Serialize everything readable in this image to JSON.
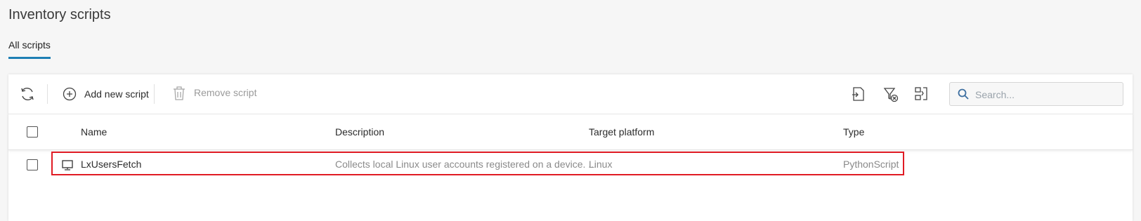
{
  "page": {
    "title": "Inventory scripts"
  },
  "tabs": [
    {
      "label": "All scripts"
    }
  ],
  "toolbar": {
    "refresh_icon": "refresh-icon",
    "add_label": "Add new script",
    "remove_label": "Remove script"
  },
  "search": {
    "placeholder": "Search...",
    "value": ""
  },
  "table": {
    "columns": [
      "Name",
      "Description",
      "Target platform",
      "Type"
    ],
    "rows": [
      {
        "icon": "monitor-icon",
        "name": "LxUsersFetch",
        "description": "Collects local Linux user accounts registered on a device. ...",
        "platform": "Linux",
        "type": "PythonScript"
      }
    ]
  },
  "colors": {
    "accent": "#1e7fb4",
    "highlight": "#e01b24"
  }
}
